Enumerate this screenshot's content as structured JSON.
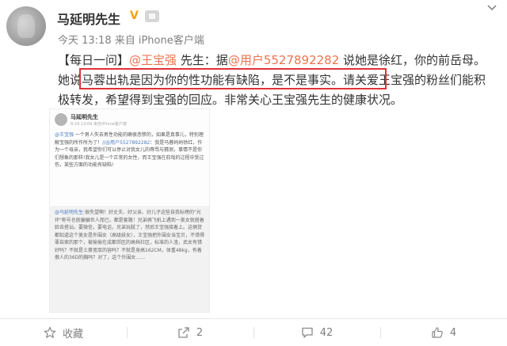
{
  "user": {
    "name": "马延明先生",
    "vip_mark": "V",
    "meta": "今天 13:18 来自 iPhone客户端"
  },
  "post": {
    "tag": "【每日一问】",
    "mention1": "@王宝强",
    "text1": " 先生：据",
    "mention2": "@用户5527892282",
    "text2": " 说她是徐红，你的前岳母。",
    "highlighted": "她说马蓉出轨是因为你的性功能有缺陷，是不是事实。",
    "text3": "请关爱王宝强的粉丝们能积极转发，希望得到宝强的回应。非常关心王宝强先生的健康状况。"
  },
  "embed": {
    "name": "马延明先生",
    "meta": "8-24 13:04 来自iPhone客户端",
    "mention1": "@王宝强",
    "body1": " 一个男人失去男性功能的确很悲惨的，如果是真事儿，特别理解宝强的所作所为了！",
    "mention2": "//@用户5527892282",
    "body2": "：我是马蓉妈妈徐红，作为一个母亲，我希望你们可以停止对我女儿的辱骂与猜测，事情不是你们想象的那样!我女儿是一个正常的女性，而王宝强在前戏的过程中受过伤，某些方面的功能有缺陷!",
    "quote_mention": "@马延明先生",
    "quote_text": ":很失望啊！好丈夫、好父亲、好儿子这些自我标榜的\"光环\"称号也就骗骗世人而已，都是套路！兄弟俩飞机上遇到一美女就搭着脸去搭讪，要微信，要电话，兄弟玩腻了，然后王宝强接着上。这俩货都知道这个美女是外围女（高级妓女），王宝强把外围女当宝贝，不惜得罪自家的那个，被偷偷在成都郊区的高档社区，标准的人渣，武女有错好吗？不就是土豪宽厚的容吗？不就是身高162CM，体重48kg，有着傲人的36D的胸吗？对了，这个外围女……"
  },
  "actions": [
    {
      "icon": "star-icon",
      "label": "收藏"
    },
    {
      "icon": "share-icon",
      "label": "2"
    },
    {
      "icon": "comment-icon",
      "label": "42"
    },
    {
      "icon": "like-icon",
      "label": "4"
    }
  ],
  "colors": {
    "mention": "#eb7350",
    "highlight_border": "#e0323a",
    "vip": "#f5a30a"
  }
}
